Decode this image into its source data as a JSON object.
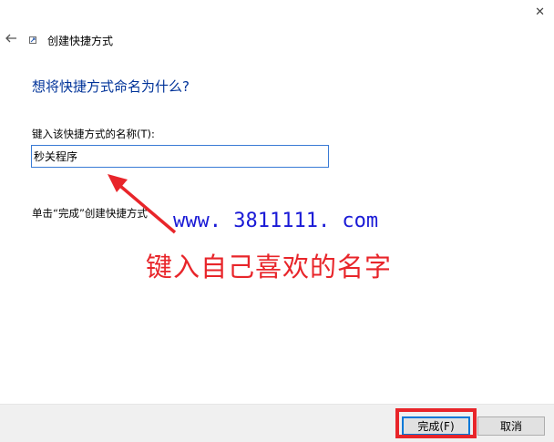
{
  "window": {
    "title": "创建快捷方式",
    "close_glyph": "✕",
    "back_icon": "back-arrow-icon",
    "title_icon": "shortcut-icon"
  },
  "main": {
    "heading": "想将快捷方式命名为什么?",
    "field_label": "键入该快捷方式的名称(T):",
    "name_value": "秒关程序",
    "hint": "单击“完成”创建快捷方式"
  },
  "overlay": {
    "watermark": "www. 3811111. com",
    "annotation": "键入自己喜欢的名字",
    "annotation_color": "#e8252a",
    "watermark_color": "#1a1ad6"
  },
  "footer": {
    "finish_label": "完成(F)",
    "cancel_label": "取消"
  },
  "colors": {
    "heading": "#003399",
    "accent": "#0078d7",
    "footer_bg": "#f0f0f0"
  }
}
